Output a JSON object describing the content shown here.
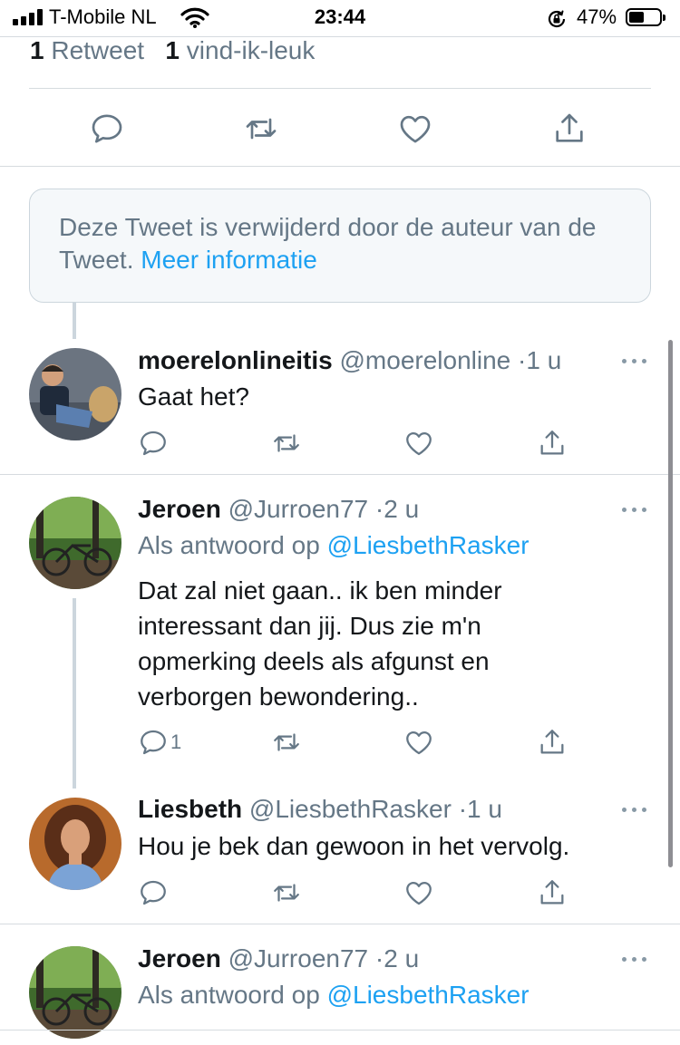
{
  "status_bar": {
    "carrier": "T-Mobile NL",
    "time": "23:44",
    "battery_percent": "47%",
    "battery_level": 0.47,
    "icons": [
      "signal-icon",
      "wifi-icon",
      "orientation-lock-icon",
      "battery-icon"
    ]
  },
  "focused_tweet": {
    "stats": {
      "retweet_count": "1",
      "retweet_label": "Retweet",
      "like_count": "1",
      "like_label": "vind-ik-leuk"
    },
    "actions": [
      "reply-icon",
      "retweet-icon",
      "like-icon",
      "share-icon"
    ]
  },
  "deleted_notice": {
    "text": "Deze Tweet is verwijderd door de auteur van de Tweet.",
    "link": "Meer informatie"
  },
  "replies": [
    {
      "name": "moerelonlineitis",
      "handle": "@moerelonline",
      "time": "1 u",
      "text": "Gaat het?",
      "reply_count": ""
    },
    {
      "name": "Jeroen",
      "handle": "@Jurroen77",
      "time": "2 u",
      "reply_prefix": "Als antwoord op",
      "reply_to": "@LiesbethRasker",
      "text": "Dat zal niet gaan.. ik ben minder interessant dan jij. Dus zie m'n opmerking deels als afgunst en verborgen bewondering..",
      "reply_count": "1"
    },
    {
      "name": "Liesbeth",
      "handle": "@LiesbethRasker",
      "time": "1 u",
      "text": "Hou je bek dan gewoon in het vervolg.",
      "reply_count": ""
    },
    {
      "name": "Jeroen",
      "handle": "@Jurroen77",
      "time": "2 u",
      "reply_prefix": "Als antwoord op",
      "reply_to": "@LiesbethRasker"
    }
  ],
  "separator": "·",
  "colors": {
    "link": "#1da1f2",
    "secondary_text": "#657786",
    "icon": "#657786",
    "border": "#d6dbdf"
  }
}
